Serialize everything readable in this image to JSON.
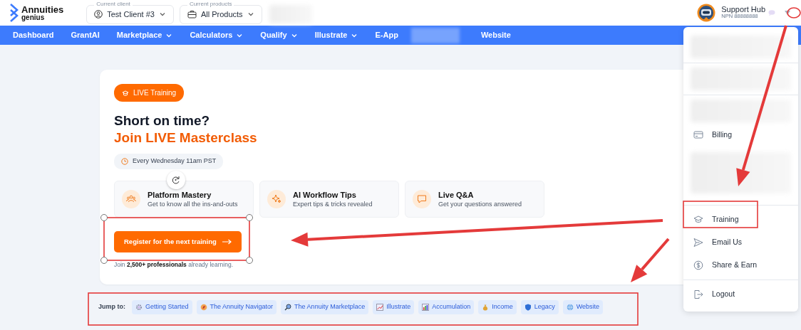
{
  "header": {
    "logo": {
      "line1": "Annuities",
      "line2": "genius"
    },
    "client_selector": {
      "label": "Current client",
      "value": "Test Client #3"
    },
    "product_selector": {
      "label": "Current products",
      "value": "All Products"
    },
    "user": {
      "name": "Support Hub",
      "npn": "NPN 88888888"
    }
  },
  "nav": [
    {
      "kind": "link",
      "label": "Dashboard",
      "dropdown": false
    },
    {
      "kind": "link",
      "label": "GrantAI",
      "dropdown": false
    },
    {
      "kind": "link",
      "label": "Marketplace",
      "dropdown": true
    },
    {
      "kind": "link",
      "label": "Calculators",
      "dropdown": true
    },
    {
      "kind": "link",
      "label": "Qualify",
      "dropdown": true
    },
    {
      "kind": "link",
      "label": "Illustrate",
      "dropdown": true
    },
    {
      "kind": "link",
      "label": "E-App",
      "dropdown": false
    },
    {
      "kind": "blurred"
    },
    {
      "kind": "link",
      "label": "Website",
      "dropdown": false
    }
  ],
  "hero": {
    "badge": "LIVE Training",
    "title": "Short on time?",
    "subtitle": "Join LIVE Masterclass",
    "schedule": "Every Wednesday 11am PST",
    "features": [
      {
        "title": "Platform Mastery",
        "description": "Get to know all the ins-and-outs"
      },
      {
        "title": "AI Workflow Tips",
        "description": "Expert tips & tricks revealed"
      },
      {
        "title": "Live Q&A",
        "description": "Get your questions answered"
      }
    ],
    "cta": "Register for the next training",
    "social_proof": "Join **2,500+ professionals** already learning."
  },
  "jump": {
    "label": "Jump to:",
    "links": [
      "Getting Started",
      "The Annuity Navigator",
      "The Annuity Marketplace",
      "Illustrate",
      "Accumulation",
      "Income",
      "Legacy",
      "Website"
    ]
  },
  "user_menu": {
    "sections": [
      [
        {
          "kind": "blurred"
        }
      ],
      [
        {
          "kind": "blurred"
        }
      ],
      [
        {
          "kind": "blurred"
        },
        {
          "kind": "link",
          "label": "Billing"
        },
        {
          "kind": "blurred"
        }
      ],
      [
        {
          "kind": "link",
          "label": "Training"
        },
        {
          "kind": "link",
          "label": "Email Us"
        },
        {
          "kind": "link",
          "label": "Share & Earn"
        }
      ],
      [
        {
          "kind": "link",
          "label": "Logout"
        }
      ]
    ]
  }
}
